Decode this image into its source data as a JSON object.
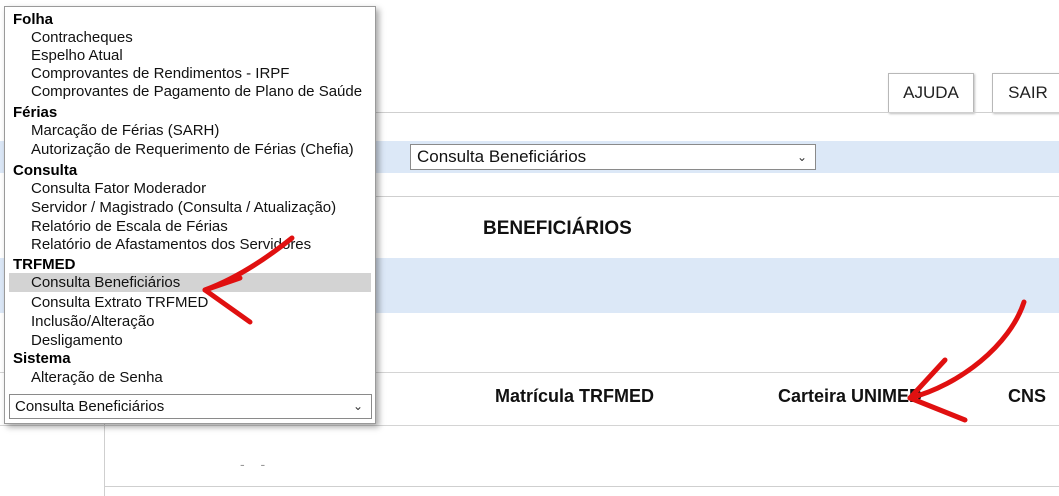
{
  "toolbar": {
    "help_label": "AJUDA",
    "exit_label": "SAIR"
  },
  "content": {
    "select_value": "Consulta Beneficiários",
    "title": "BENEFICIÁRIOS",
    "columns": [
      "Matrícula TRFMED",
      "Carteira UNIMED",
      "CNS"
    ],
    "row_placeholder": "- -"
  },
  "menu": {
    "groups": [
      {
        "label": "Folha",
        "items": [
          "Contracheques",
          "Espelho Atual",
          "Comprovantes de Rendimentos - IRPF",
          "Comprovantes de Pagamento de Plano de Saúde"
        ]
      },
      {
        "label": "Férias",
        "items": [
          "Marcação de Férias (SARH)",
          "Autorização de Requerimento de Férias (Chefia)"
        ]
      },
      {
        "label": "Consulta",
        "items": [
          "Consulta Fator Moderador",
          "Servidor / Magistrado (Consulta / Atualização)",
          "Relatório de Escala de Férias",
          "Relatório de Afastamentos dos Servidores"
        ]
      },
      {
        "label": "TRFMED",
        "items": [
          "Consulta Beneficiários",
          "Consulta Extrato TRFMED",
          "Inclusão/Alteração",
          "Desligamento"
        ]
      },
      {
        "label": "Sistema",
        "items": [
          "Alteração de Senha"
        ]
      }
    ],
    "selected_item": "Consulta Beneficiários",
    "select_value": "Consulta Beneficiários"
  },
  "colors": {
    "band": "#dce8f7",
    "arrow": "#e01010",
    "selected": "#d3d3d3"
  }
}
